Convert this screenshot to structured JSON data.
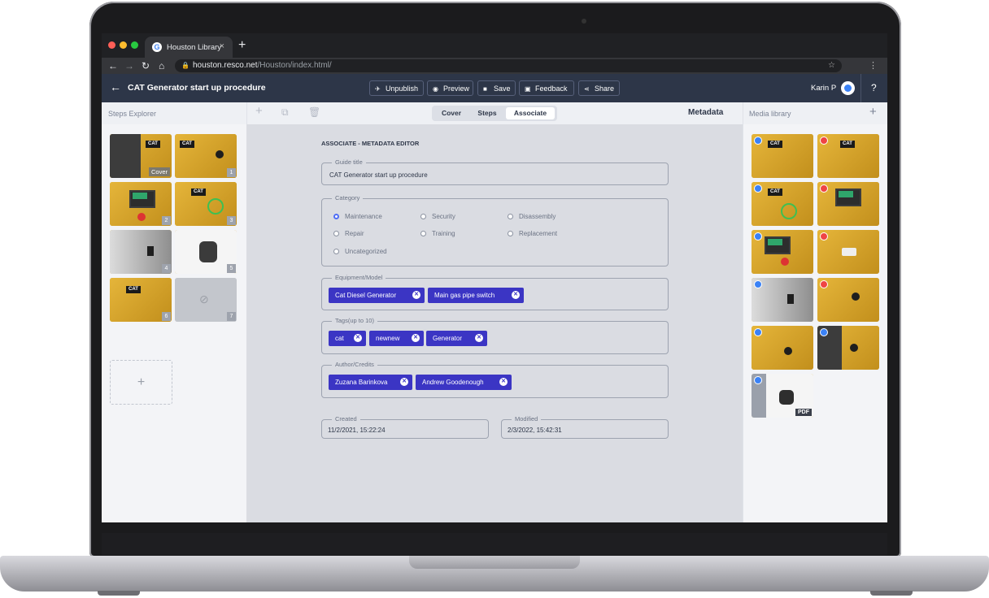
{
  "browser": {
    "tab_title": "Houston Library",
    "tab_close": "×",
    "new_tab": "+",
    "url_host": "houston.resco.net",
    "url_path": "/Houston/index.html/"
  },
  "header": {
    "back_icon": "←",
    "title": "CAT Generator start up procedure",
    "buttons": [
      {
        "label": "Unpublish",
        "icon": "rocket-icon"
      },
      {
        "label": "Preview",
        "icon": "eye-icon"
      },
      {
        "label": "Save",
        "icon": "save-icon"
      },
      {
        "label": "Feedback",
        "icon": "feedback-icon"
      },
      {
        "label": "Share",
        "icon": "share-icon"
      }
    ],
    "user_name": "Karin P",
    "help": "?"
  },
  "steps_explorer": {
    "title": "Steps Explorer",
    "cover_label": "Cover",
    "step_numbers": [
      "1",
      "2",
      "3",
      "4",
      "5",
      "6",
      "7"
    ],
    "add": "+"
  },
  "view_tabs": {
    "items": [
      "Cover",
      "Steps",
      "Associate"
    ],
    "active": "Associate"
  },
  "metadata_title": "Metadata",
  "media_library": {
    "title": "Media library",
    "add": "+",
    "pdf_label": "PDF"
  },
  "editor": {
    "heading": "ASSOCIATE - METADATA EDITOR",
    "guide_title_label": "Guide title",
    "guide_title_value": "CAT Generator start up procedure",
    "category_label": "Category",
    "categories": [
      "Maintenance",
      "Security",
      "Disassembly",
      "Repair",
      "Training",
      "Replacement",
      "Uncategorized"
    ],
    "selected_category": "Maintenance",
    "equipment_label": "Equipment/Model",
    "equipment": [
      "Cat Diesel Generator",
      "Main gas pipe switch"
    ],
    "tags_label": "Tags(up to 10)",
    "tags": [
      "cat",
      "newnew",
      "Generator"
    ],
    "author_label": "Author/Credits",
    "authors": [
      "Zuzana Barinkova",
      "Andrew Goodenough"
    ],
    "created_label": "Created",
    "created_value": "11/2/2021, 15:22:24",
    "modified_label": "Modified",
    "modified_value": "2/3/2022, 15:42:31"
  },
  "colors": {
    "header_bg": "#2d3648",
    "chip_bg": "#3b35c4",
    "radio_selected": "#4f6df5"
  }
}
